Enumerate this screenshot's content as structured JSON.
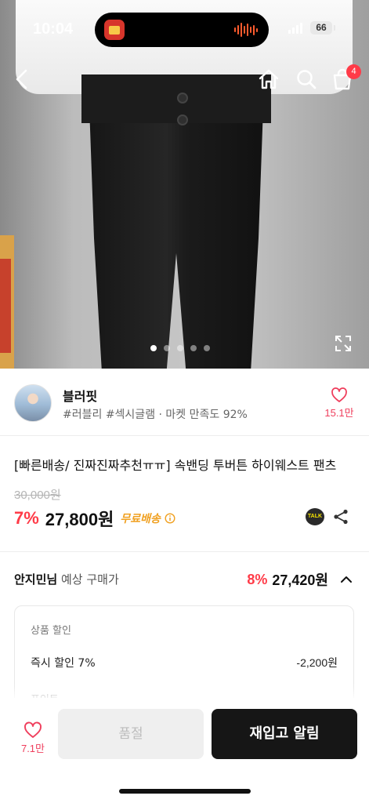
{
  "status_bar": {
    "time": "10:04",
    "battery": "66"
  },
  "nav": {
    "cart_count": "4"
  },
  "gallery": {
    "total_images": 5,
    "active_index": 0
  },
  "seller": {
    "name": "블러핏",
    "tags": "#러블리 #섹시글램 · 마켓 만족도 92%",
    "likes": "15.1만"
  },
  "product": {
    "title": "[빠른배송/ 진짜진짜추천ㅠㅠ] 속밴딩 투버튼 하이웨스트 팬츠",
    "original_price": "30,000원",
    "discount": "7%",
    "price": "27,800원",
    "shipping": "무료배송",
    "talk_label": "TALK"
  },
  "expected": {
    "user": "안지민님",
    "label": " 예상 구매가",
    "discount": "8%",
    "price": "27,420원"
  },
  "discount_panel": {
    "heading": "상품 할인",
    "row_label": "즉시 할인 7%",
    "row_value": "-2,200원",
    "next_heading": "포인트"
  },
  "bottom_bar": {
    "likes": "7.1만",
    "soldout_label": "품절",
    "restock_label": "재입고 알림"
  },
  "colors": {
    "accent": "#ff3b48",
    "like": "#ef3e5c",
    "free_shipping": "#f0a020",
    "primary_button": "#161616"
  }
}
